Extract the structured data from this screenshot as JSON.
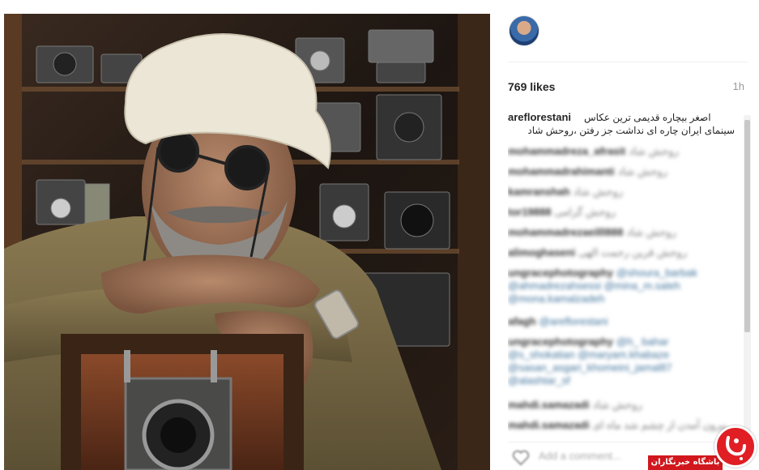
{
  "post": {
    "likes": "769 likes",
    "time_ago": "1h",
    "caption": {
      "username": "areflorestani",
      "line1": "اصغر بیچاره قدیمی ترین عکاس",
      "line2": "سینمای ایران چاره ای نداشت جز رفتن ،روحش شاد"
    }
  },
  "comments": [
    {
      "user": "mohammadreza_afrasit",
      "text": "روحش شاد"
    },
    {
      "user": "mohammadrahimanti",
      "text": "روحش شاد"
    },
    {
      "user": "kamranshah",
      "text": "روحش شاد"
    },
    {
      "user": "tor19888",
      "text": "روحش گرامی"
    },
    {
      "user": "mohammadrezaeilll888",
      "text": "روحش شاد"
    },
    {
      "user": "alimoghaseni",
      "text": "روحش قرین رحمت الهی"
    },
    {
      "user": "ungracephotography",
      "text": "@shoura_barbak @ahmadrezahsessi @mina_m.saleh @mona.kamalzadeh"
    },
    {
      "user": "afagh",
      "text": "@areflorestani"
    },
    {
      "user": "ungracephotography",
      "text": "@h_ bahar @s_shokatian @maryam.khabaze @sasan_asgari_khomeini_jamal87 @alashtar_sf"
    },
    {
      "user": "mahdi.samazadi",
      "text": "روحش شاد"
    },
    {
      "user": "mahdi.samazadi",
      "text": "بیرون آمدن از چشم شد ماه ای"
    }
  ],
  "footer": {
    "add_comment_placeholder": "Add a comment..."
  },
  "watermark": {
    "label": "باشگاه خبرنگاران"
  },
  "colors": {
    "link": "#3f729b",
    "badge_red": "#d0171d",
    "text": "#262626",
    "muted": "#999999"
  },
  "icons": {
    "heart": "heart-icon",
    "avatar": "avatar"
  }
}
